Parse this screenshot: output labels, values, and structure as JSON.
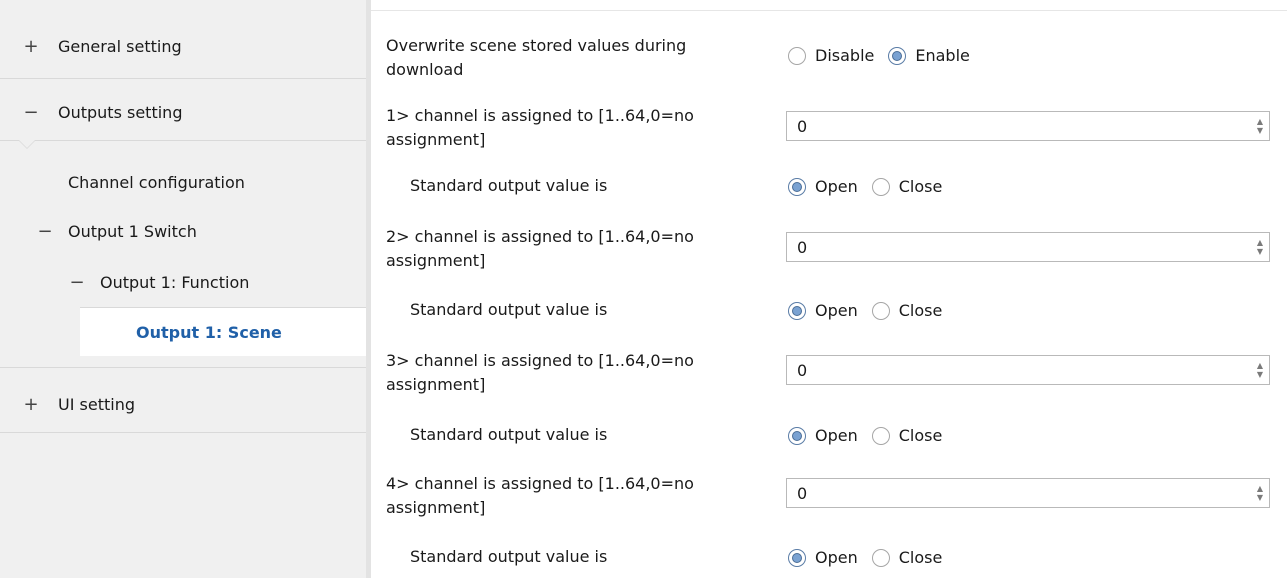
{
  "sidebar": {
    "general_setting": "General setting",
    "outputs_setting": "Outputs setting",
    "channel_configuration": "Channel configuration",
    "output1_switch": "Output 1 Switch",
    "output1_function": "Output 1: Function",
    "output1_scene": "Output 1: Scene",
    "ui_setting": "UI setting",
    "expand_symbol": "+",
    "collapse_symbol": "−"
  },
  "main": {
    "overwrite": {
      "label_line1": "Overwrite scene stored values during",
      "label_line2": "download",
      "options": [
        "Disable",
        "Enable"
      ],
      "selected": "Enable"
    },
    "channels": [
      {
        "assign_line1": "1> channel is assigned to [1..64,0=no",
        "assign_line2": "assignment]",
        "value": "0",
        "std_label": "Standard output value is",
        "options": [
          "Open",
          "Close"
        ],
        "selected": "Open"
      },
      {
        "assign_line1": "2> channel is assigned to [1..64,0=no",
        "assign_line2": "assignment]",
        "value": "0",
        "std_label": "Standard output value is",
        "options": [
          "Open",
          "Close"
        ],
        "selected": "Open"
      },
      {
        "assign_line1": "3> channel is assigned to [1..64,0=no",
        "assign_line2": "assignment]",
        "value": "0",
        "std_label": "Standard output value is",
        "options": [
          "Open",
          "Close"
        ],
        "selected": "Open"
      },
      {
        "assign_line1": "4> channel is assigned to [1..64,0=no",
        "assign_line2": "assignment]",
        "value": "0",
        "std_label": "Standard output value is",
        "options": [
          "Open",
          "Close"
        ],
        "selected": "Open"
      }
    ]
  },
  "colors": {
    "selected_text": "#2060a8",
    "sidebar_bg": "#f0f0f0",
    "radio_fill": "#7aa2d2"
  }
}
